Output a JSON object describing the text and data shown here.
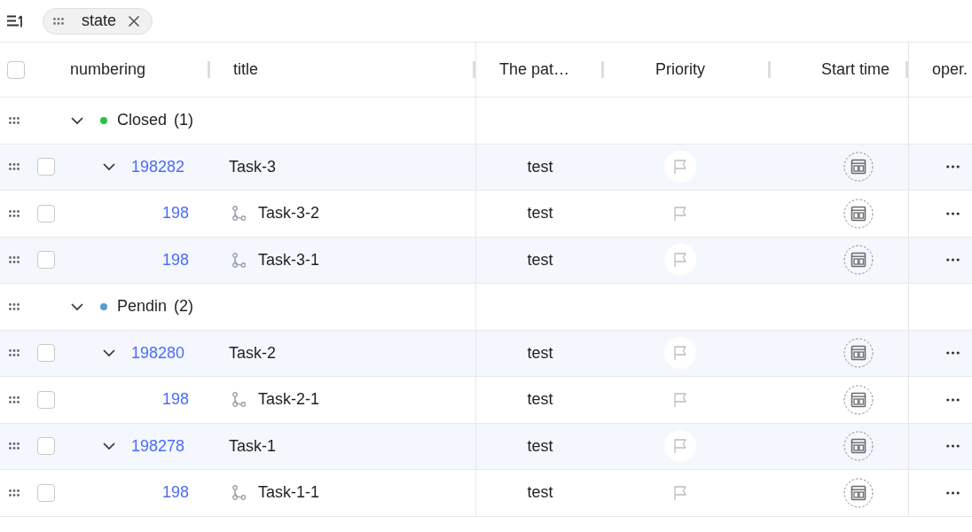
{
  "toolbar": {
    "filters": [
      {
        "label": "state"
      }
    ]
  },
  "table": {
    "select_all": {
      "checked": false
    },
    "columns": [
      {
        "label": "numbering"
      },
      {
        "label": "title"
      },
      {
        "label": "The pat…"
      },
      {
        "label": "Priority"
      },
      {
        "label": "Start time"
      },
      {
        "label": "oper."
      }
    ],
    "groups": [
      {
        "label": "Closed",
        "count": "(1)",
        "color": "#2ec23f",
        "expanded": true,
        "tasks": [
          {
            "number": "198282",
            "title": "Task-3",
            "column_3": "test",
            "checked": false,
            "expanded": true,
            "children": [
              {
                "number": "198",
                "title": "Task-3-2",
                "column_3": "test",
                "checked": false
              },
              {
                "number": "198",
                "title": "Task-3-1",
                "column_3": "test",
                "checked": false
              }
            ]
          }
        ]
      },
      {
        "label": "Pendin",
        "count": "(2)",
        "color": "#5b9bc9",
        "expanded": true,
        "tasks": [
          {
            "number": "198280",
            "title": "Task-2",
            "column_3": "test",
            "checked": false,
            "expanded": true,
            "children": [
              {
                "number": "198",
                "title": "Task-2-1",
                "column_3": "test",
                "checked": false
              }
            ]
          },
          {
            "number": "198278",
            "title": "Task-1",
            "column_3": "test",
            "checked": false,
            "expanded": true,
            "children": [
              {
                "number": "198",
                "title": "Task-1-1",
                "column_3": "test",
                "checked": false
              }
            ]
          }
        ]
      }
    ]
  }
}
